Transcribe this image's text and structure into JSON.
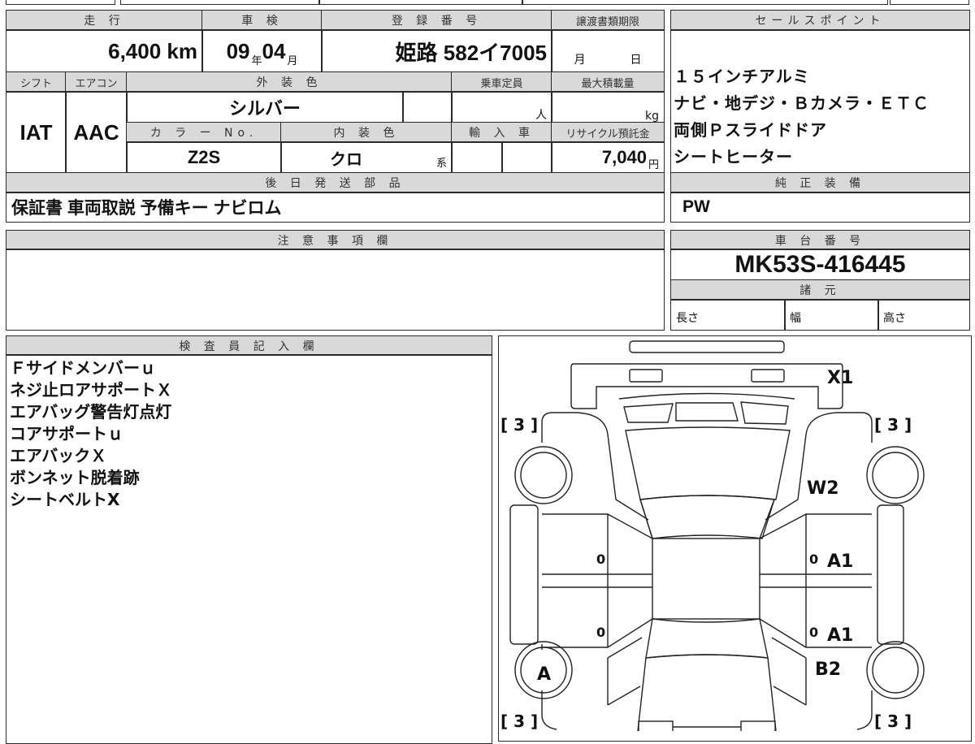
{
  "top": {
    "mileage_label": "走 行",
    "mileage_value": "6,400",
    "mileage_unit": "km",
    "inspection_label": "車 検",
    "inspection_year": "09",
    "year_unit": "年",
    "inspection_month": "04",
    "month_unit": "月",
    "registration_label": "登 録 番 号",
    "registration_value": "姫路 582イ7005",
    "transfer_label": "譲渡書類期限",
    "transfer_month_unit": "月",
    "transfer_day_unit": "日",
    "shift_label": "シフト",
    "shift_value": "IAT",
    "aircon_label": "エアコン",
    "aircon_value": "AAC",
    "exterior_label": "外 装 色",
    "exterior_value": "シルバー",
    "capacity_label": "乗車定員",
    "capacity_unit": "人",
    "maxload_label": "最大積載量",
    "maxload_unit": "kg",
    "colorno_label": "カ ラ ー No.",
    "colorno_value": "Z2S",
    "interior_label": "内 装 色",
    "interior_value": "クロ",
    "interior_unit": "系",
    "import_label": "輸 入 車",
    "recycle_label": "リサイクル預託金",
    "recycle_value": "7,040",
    "recycle_unit": "円",
    "later_parts_label": "後 日 発 送 部 品",
    "later_parts_value": "保証書 車両取説 予備キー ナビロム"
  },
  "sales": {
    "label": "セールスポイント",
    "lines": [
      "１５インチアルミ",
      "ナビ・地デジ・Ｂカメラ・ＥＴＣ",
      "両側Ｐスライドドア",
      "シートヒーター"
    ],
    "equip_label": "純 正 装 備",
    "equip_value": "PW"
  },
  "notes_label": "注 意 事 項 欄",
  "chassis": {
    "label": "車 台 番 号",
    "value": "MK53S-416445",
    "spec_label": "諸 元",
    "length_label": "長さ",
    "width_label": "幅",
    "height_label": "高さ"
  },
  "inspector": {
    "label": "検 査 員 記 入 欄",
    "lines": [
      "Ｆサイドメンバーｕ",
      "ネジ止ロアサポートＸ",
      "エアバッグ警告灯点灯",
      "コアサポートｕ",
      "エアバックＸ",
      "ボンネット脱着跡",
      "シートベルトX"
    ]
  },
  "diagram": {
    "marks": {
      "front": "X1",
      "windshield": "W2",
      "door_rf": "A1",
      "door_rr": "A1",
      "fender_rr": "B2",
      "wheel_lr": "A"
    },
    "zeros": "0",
    "tire": "[ 3 ]"
  }
}
